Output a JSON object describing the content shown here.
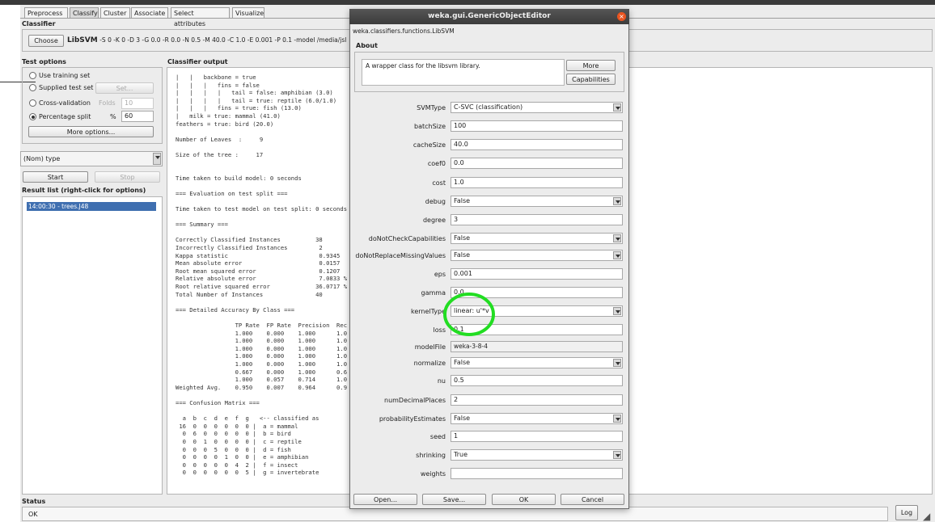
{
  "explorer": {
    "tabs": [
      "Preprocess",
      "Classify",
      "Cluster",
      "Associate",
      "Select attributes",
      "Visualize"
    ],
    "classifier_section": "Classifier",
    "choose_label": "Choose",
    "classifier_name": "LibSVM",
    "classifier_options": "-S 0 -K 0 -D 3 -G 0.0 -R 0.0 -N 0.5 -M 40.0 -C 1.0 -E 0.001 -P 0.1 -model /media/jsl",
    "test_options_label": "Test options",
    "use_training_set": "Use training set",
    "supplied_test_set": "Supplied test set",
    "set_button": "Set...",
    "cross_validation": "Cross-validation",
    "folds_label": "Folds",
    "folds_value": "10",
    "percentage_split": "Percentage split",
    "percent_symbol": "%",
    "percent_value": "60",
    "more_options": "More options...",
    "class_attribute": "(Nom) type",
    "start_button": "Start",
    "stop_button": "Stop",
    "result_list_label": "Result list (right-click for options)",
    "result_item": "14:00:30 - trees.J48",
    "output_label": "Classifier output",
    "output_text": "|   |   backbone = true\n|   |   |   fins = false\n|   |   |   |   tail = false: amphibian (3.0)\n|   |   |   |   tail = true: reptile (6.0/1.0)\n|   |   |   fins = true: fish (13.0)\n|   milk = true: mammal (41.0)\nfeathers = true: bird (20.0)\n\nNumber of Leaves  :     9\n\nSize of the tree :     17\n\n\nTime taken to build model: 0 seconds\n\n=== Evaluation on test split ===\n\nTime taken to test model on test split: 0 seconds\n\n=== Summary ===\n\nCorrectly Classified Instances          38\nIncorrectly Classified Instances         2\nKappa statistic                          0.9345\nMean absolute error                      0.0157\nRoot mean squared error                  0.1207\nRelative absolute error                  7.0833 %\nRoot relative squared error             36.0717 %\nTotal Number of Instances               40\n\n=== Detailed Accuracy By Class ===\n\n                 TP Rate  FP Rate  Precision  Rec\n                 1.000    0.000    1.000      1.0\n                 1.000    0.000    1.000      1.0\n                 1.000    0.000    1.000      1.0\n                 1.000    0.000    1.000      1.0\n                 1.000    0.000    1.000      1.0\n                 0.667    0.000    1.000      0.6\n                 1.000    0.057    0.714      1.0\nWeighted Avg.    0.950    0.007    0.964      0.9\n\n=== Confusion Matrix ===\n\n  a  b  c  d  e  f  g   <-- classified as\n 16  0  0  0  0  0  0 |  a = mammal\n  0  6  0  0  0  0  0 |  b = bird\n  0  0  1  0  0  0  0 |  c = reptile\n  0  0  0  5  0  0  0 |  d = fish\n  0  0  0  0  1  0  0 |  e = amphibian\n  0  0  0  0  0  4  2 |  f = insect\n  0  0  0  0  0  0  5 |  g = invertebrate",
    "status_label": "Status",
    "status_text": "OK",
    "log_button": "Log"
  },
  "dialog": {
    "title": "weka.gui.GenericObjectEditor",
    "class_path": "weka.classifiers.functions.LibSVM",
    "about_label": "About",
    "about_text": "A wrapper class for the libsvm library.",
    "more_button": "More",
    "capabilities_button": "Capabilities",
    "params": [
      {
        "label": "SVMType",
        "value": "C-SVC (classification)",
        "kind": "combo"
      },
      {
        "label": "batchSize",
        "value": "100",
        "kind": "text"
      },
      {
        "label": "cacheSize",
        "value": "40.0",
        "kind": "text"
      },
      {
        "label": "coef0",
        "value": "0.0",
        "kind": "text"
      },
      {
        "label": "cost",
        "value": "1.0",
        "kind": "text"
      },
      {
        "label": "debug",
        "value": "False",
        "kind": "combo"
      },
      {
        "label": "degree",
        "value": "3",
        "kind": "text"
      },
      {
        "label": "doNotCheckCapabilities",
        "value": "False",
        "kind": "combo"
      },
      {
        "label": "doNotReplaceMissingValues",
        "value": "False",
        "kind": "combo"
      },
      {
        "label": "eps",
        "value": "0.001",
        "kind": "text"
      },
      {
        "label": "gamma",
        "value": "0.0",
        "kind": "text"
      },
      {
        "label": "kernelType",
        "value": "linear: u'*v",
        "kind": "combo"
      },
      {
        "label": "loss",
        "value": "0.1",
        "kind": "text"
      },
      {
        "label": "modelFile",
        "value": "weka-3-8-4",
        "kind": "file"
      },
      {
        "label": "normalize",
        "value": "False",
        "kind": "combo"
      },
      {
        "label": "nu",
        "value": "0.5",
        "kind": "text"
      },
      {
        "label": "numDecimalPlaces",
        "value": "2",
        "kind": "text"
      },
      {
        "label": "probabilityEstimates",
        "value": "False",
        "kind": "combo"
      },
      {
        "label": "seed",
        "value": "1",
        "kind": "text"
      },
      {
        "label": "shrinking",
        "value": "True",
        "kind": "combo"
      },
      {
        "label": "weights",
        "value": "",
        "kind": "text"
      }
    ],
    "open_button": "Open...",
    "save_button": "Save...",
    "ok_button": "OK",
    "cancel_button": "Cancel"
  },
  "colors": {
    "highlight_circle": "#22dd22",
    "title_bar": "#4a4a4a",
    "close_button": "#e95420",
    "selection": "#3f6fb0"
  }
}
